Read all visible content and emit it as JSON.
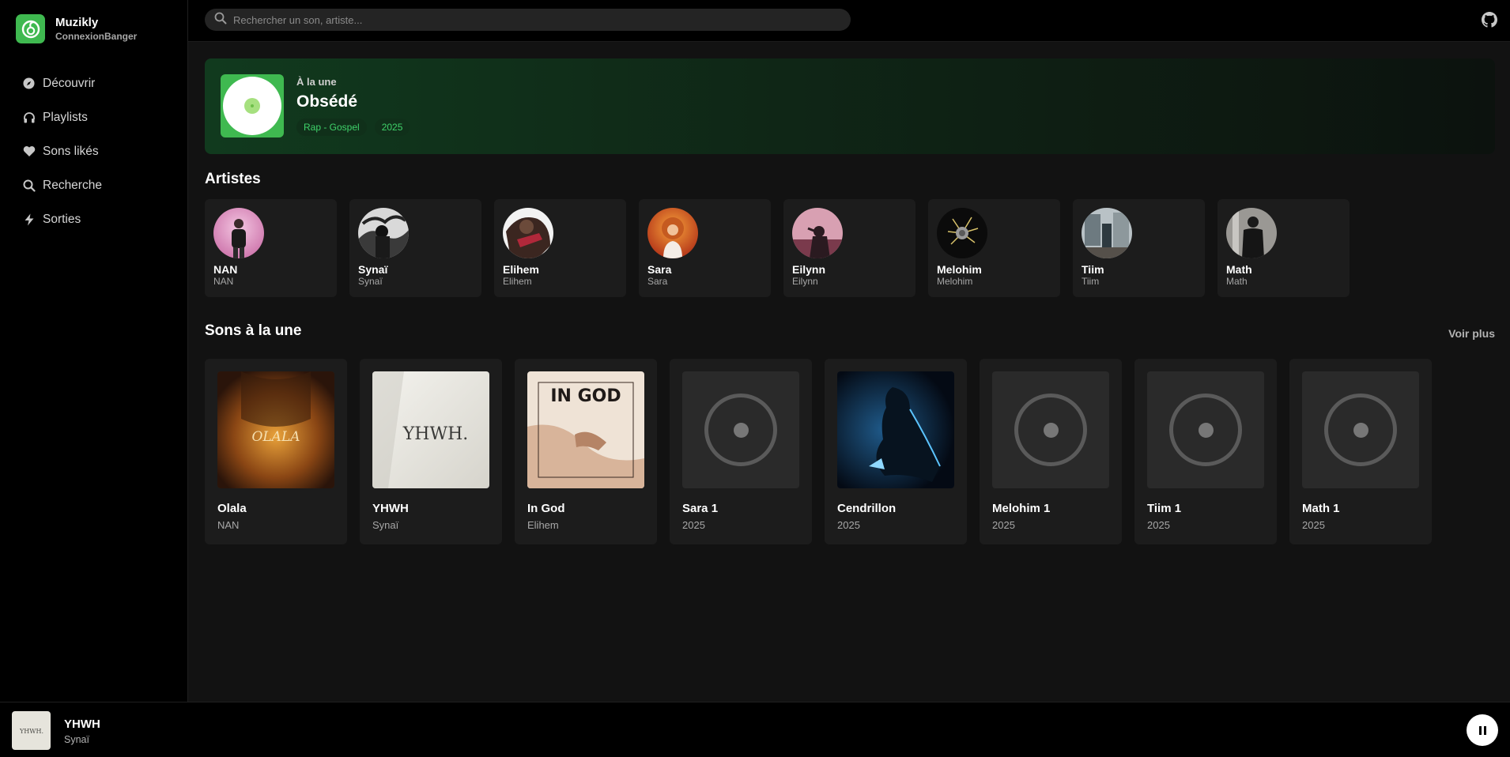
{
  "brand": {
    "name": "Muzikly",
    "user": "ConnexionBanger",
    "color": "#3fb950"
  },
  "nav": [
    {
      "label": "Découvrir",
      "icon": "compass-icon"
    },
    {
      "label": "Playlists",
      "icon": "headphones-icon"
    },
    {
      "label": "Sons likés",
      "icon": "heart-icon"
    },
    {
      "label": "Recherche",
      "icon": "search-icon"
    },
    {
      "label": "Sorties",
      "icon": "bolt-icon"
    }
  ],
  "search": {
    "placeholder": "Rechercher un son, artiste..."
  },
  "hero": {
    "kicker": "À la une",
    "title": "Obsédé",
    "tags": [
      "Rap - Gospel",
      "2025"
    ]
  },
  "artists_section": {
    "title": "Artistes"
  },
  "artists": [
    {
      "name": "NAN",
      "sub": "NAN"
    },
    {
      "name": "Synaï",
      "sub": "Synaï"
    },
    {
      "name": "Elihem",
      "sub": "Elihem"
    },
    {
      "name": "Sara",
      "sub": "Sara"
    },
    {
      "name": "Eilynn",
      "sub": "Eilynn"
    },
    {
      "name": "Melohim",
      "sub": "Melohim"
    },
    {
      "name": "Tiim",
      "sub": "Tiim"
    },
    {
      "name": "Math",
      "sub": "Math"
    }
  ],
  "tracks_section": {
    "title": "Sons à la une",
    "more": "Voir plus"
  },
  "tracks": [
    {
      "title": "Olala",
      "sub": "NAN",
      "cover_text": "OLALA"
    },
    {
      "title": "YHWH",
      "sub": "Synaï",
      "cover_text": "YHWH."
    },
    {
      "title": "In God",
      "sub": "Elihem",
      "cover_text": "IN GOD"
    },
    {
      "title": "Sara 1",
      "sub": "2025"
    },
    {
      "title": "Cendrillon",
      "sub": "2025"
    },
    {
      "title": "Melohim 1",
      "sub": "2025"
    },
    {
      "title": "Tiim 1",
      "sub": "2025"
    },
    {
      "title": "Math 1",
      "sub": "2025"
    }
  ],
  "player": {
    "title": "YHWH",
    "artist": "Synaï",
    "cover_text": "YHWH."
  }
}
